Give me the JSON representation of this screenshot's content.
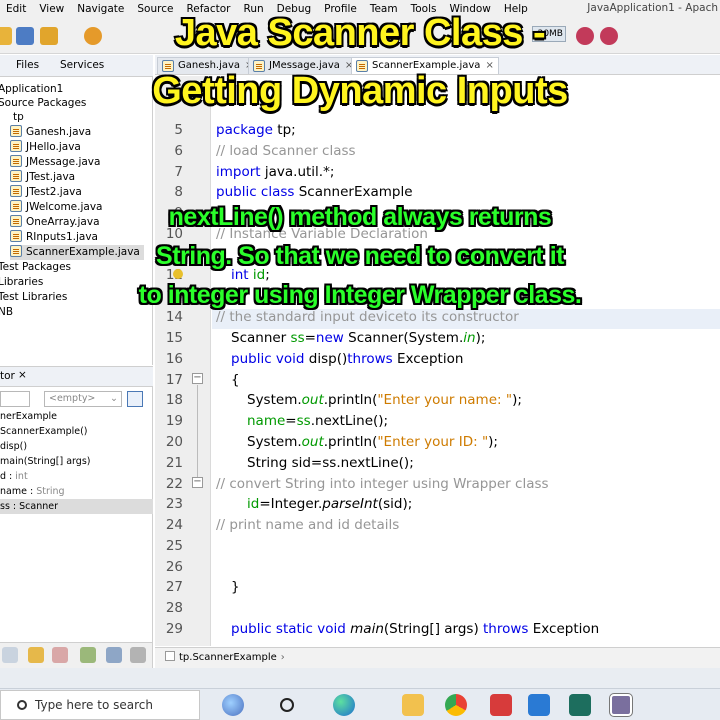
{
  "menubar": {
    "items": [
      "Edit",
      "View",
      "Navigate",
      "Source",
      "Refactor",
      "Run",
      "Debug",
      "Profile",
      "Team",
      "Tools",
      "Window",
      "Help"
    ],
    "app_title": "JavaApplication1 - Apach"
  },
  "toolbar": {
    "memory_label": "20MB"
  },
  "projects_panel": {
    "tabs": [
      "Files",
      "Services"
    ],
    "tree": [
      {
        "label": "Application1",
        "indent": 0,
        "icon": false
      },
      {
        "label": "Source Packages",
        "indent": 0,
        "icon": false
      },
      {
        "label": "tp",
        "indent": 1,
        "icon": false
      },
      {
        "label": "Ganesh.java",
        "indent": 2,
        "icon": true
      },
      {
        "label": "JHello.java",
        "indent": 2,
        "icon": true
      },
      {
        "label": "JMessage.java",
        "indent": 2,
        "icon": true
      },
      {
        "label": "JTest.java",
        "indent": 2,
        "icon": true
      },
      {
        "label": "JTest2.java",
        "indent": 2,
        "icon": true
      },
      {
        "label": "JWelcome.java",
        "indent": 2,
        "icon": true
      },
      {
        "label": "OneArray.java",
        "indent": 2,
        "icon": true
      },
      {
        "label": "RInputs1.java",
        "indent": 2,
        "icon": true
      },
      {
        "label": "ScannerExample.java",
        "indent": 2,
        "icon": true,
        "selected": true
      },
      {
        "label": "Test Packages",
        "indent": 0,
        "icon": false
      },
      {
        "label": "Libraries",
        "indent": 0,
        "icon": false
      },
      {
        "label": "Test Libraries",
        "indent": 0,
        "icon": false
      },
      {
        "label": "NB",
        "indent": 0,
        "icon": false
      }
    ]
  },
  "navigator": {
    "tab_label": "tor",
    "tab_close": "×",
    "filter_placeholder": "<empty>",
    "members": [
      {
        "name": "nerExample",
        "type": ""
      },
      {
        "name": "ScannerExample()",
        "type": ""
      },
      {
        "name": "disp()",
        "type": ""
      },
      {
        "name": "main(String[] args)",
        "type": ""
      },
      {
        "name": "d : ",
        "type": "int"
      },
      {
        "name": "name : ",
        "type": "String"
      },
      {
        "name": "ss : Scanner",
        "type": "",
        "selected": true
      }
    ]
  },
  "editor": {
    "tabs": [
      {
        "label": "Ganesh.java",
        "close": "×",
        "active": false
      },
      {
        "label": "JMessage.java",
        "close": "×",
        "active": false
      },
      {
        "label": "ScannerExample.java",
        "close": "×",
        "active": true
      }
    ],
    "line_numbers": [
      "5",
      "6",
      "7",
      "8",
      "9",
      "10",
      "11",
      "12",
      "13",
      "14",
      "15",
      "16",
      "17",
      "18",
      "19",
      "20",
      "21",
      "22",
      "23",
      "24",
      "25",
      "26",
      "27",
      "28",
      "29"
    ],
    "code": {
      "l5_kw": "package",
      "l5_rest": " tp;",
      "l6": "// load Scanner class",
      "l7_kw": "import",
      "l7_rest": " java.util.*;",
      "l8_kw": "public class",
      "l8_rest": " ScannerExample",
      "l10": "// Instance Variable Declaration",
      "l12_kw": "int",
      "l12_fld": "id",
      "l14": "// the standard input deviceto its constructor",
      "l15_a": "Scanner ",
      "l15_fld": "ss",
      "l15_b": "=",
      "l15_kw": "new",
      "l15_c": " Scanner(System.",
      "l15_stat": "in",
      "l15_d": ");",
      "l16_kw": "public void",
      "l16_a": " disp()",
      "l16_kw2": "throws",
      "l16_b": " Exception",
      "l17": "{",
      "l18_a": "System.",
      "l18_stat": "out",
      "l18_b": ".println(",
      "l18_str": "\"Enter your name: \"",
      "l18_c": ");",
      "l19_fld": "name",
      "l19_a": "=",
      "l19_fld2": "ss",
      "l19_b": ".nextLine();",
      "l20_a": "System.",
      "l20_stat": "out",
      "l20_b": ".println(",
      "l20_str": "\"Enter your ID: \"",
      "l20_c": ");",
      "l21": "String sid=ss.nextLine();",
      "l21_a": "String sid=",
      "l21_fld": "ss",
      "l21_b": ".nextLine();",
      "l22": "// convert String into integer using Wrapper class",
      "l23_fld": "id",
      "l23_a": "=Integer.",
      "l23_it": "parseInt",
      "l23_b": "(sid);",
      "l24": "// print name and id details",
      "l27": "}",
      "l29_kw": "public static void",
      "l29_it": "main",
      "l29_a": "(String[] args) ",
      "l29_kw2": "throws",
      "l29_b": " Exception"
    },
    "breadcrumb": "tp.ScannerExample"
  },
  "overlay": {
    "title_line1": "Java Scanner Class -",
    "title_line2": "Getting Dynamic Inputs",
    "note_line1": "nextLine() method always returns",
    "note_line2": "String. So that we need to convert it",
    "note_line3": "to integer using Integer Wrapper class."
  },
  "taskbar": {
    "search_placeholder": "Type here to search"
  }
}
